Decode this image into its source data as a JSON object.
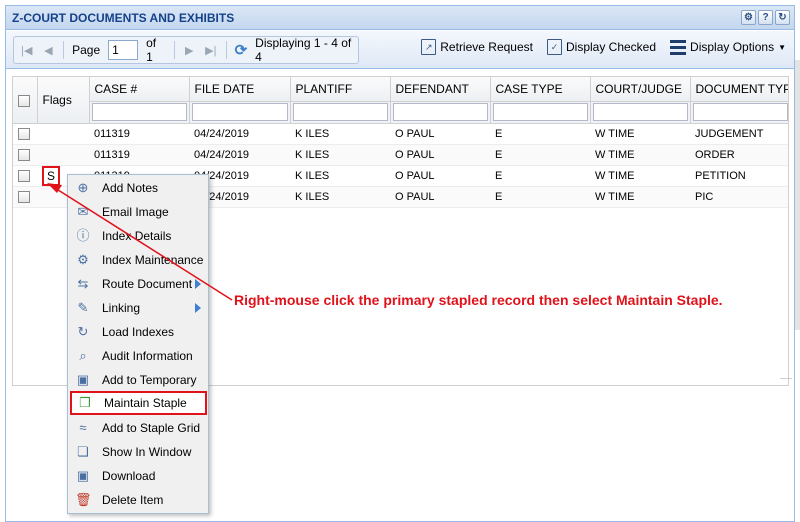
{
  "panel": {
    "title": "Z-COURT DOCUMENTS AND EXHIBITS"
  },
  "pager": {
    "page_label": "Page",
    "page_value": "1",
    "of_label": "of 1",
    "display_text": "Displaying 1 - 4 of 4"
  },
  "toolbar": {
    "retrieve_label": "Retrieve Request",
    "display_checked_label": "Display Checked",
    "display_options_label": "Display Options"
  },
  "grid": {
    "columns": [
      "Flags",
      "CASE #",
      "FILE DATE",
      "PLANTIFF",
      "DEFENDANT",
      "CASE TYPE",
      "COURT/JUDGE",
      "DOCUMENT TYPE"
    ],
    "rows": [
      {
        "flag": "",
        "case": "011319",
        "date": "04/24/2019",
        "plaintiff": "K ILES",
        "defendant": "O PAUL",
        "type": "E",
        "judge": "W TIME",
        "doctype": "JUDGEMENT"
      },
      {
        "flag": "",
        "case": "011319",
        "date": "04/24/2019",
        "plaintiff": "K ILES",
        "defendant": "O PAUL",
        "type": "E",
        "judge": "W TIME",
        "doctype": "ORDER"
      },
      {
        "flag": "S",
        "case": "011319",
        "date": "04/24/2019",
        "plaintiff": "K ILES",
        "defendant": "O PAUL",
        "type": "E",
        "judge": "W TIME",
        "doctype": "PETITION"
      },
      {
        "flag": "",
        "case": "011319",
        "date": "04/24/2019",
        "plaintiff": "K ILES",
        "defendant": "O PAUL",
        "type": "E",
        "judge": "W TIME",
        "doctype": "PIC"
      }
    ]
  },
  "context_menu": {
    "items": [
      {
        "label": "Add Notes",
        "icon": "plus-circle-icon",
        "submenu": false
      },
      {
        "label": "Email Image",
        "icon": "envelope-icon",
        "submenu": false
      },
      {
        "label": "Index Details",
        "icon": "info-icon",
        "submenu": false
      },
      {
        "label": "Index Maintenance",
        "icon": "gear-document-icon",
        "submenu": false
      },
      {
        "label": "Route Document",
        "icon": "route-arrows-icon",
        "submenu": true
      },
      {
        "label": "Linking",
        "icon": "link-document-icon",
        "submenu": true
      },
      {
        "label": "Load Indexes",
        "icon": "reload-icon",
        "submenu": false
      },
      {
        "label": "Audit Information",
        "icon": "audit-magnifier-icon",
        "submenu": false
      },
      {
        "label": "Add to Temporary",
        "icon": "save-disk-icon",
        "submenu": false
      },
      {
        "label": "Maintain Staple",
        "icon": "staple-document-icon",
        "submenu": false,
        "highlighted": true
      },
      {
        "label": "Add to Staple Grid",
        "icon": "stapler-icon",
        "submenu": false
      },
      {
        "label": "Show In Window",
        "icon": "window-icon",
        "submenu": false
      },
      {
        "label": "Download",
        "icon": "download-disk-icon",
        "submenu": false
      },
      {
        "label": "Delete Item",
        "icon": "trash-icon",
        "submenu": false
      }
    ]
  },
  "annotation": {
    "text": "Right-mouse click the primary stapled record then select Maintain Staple.",
    "color": "#e0121a"
  }
}
